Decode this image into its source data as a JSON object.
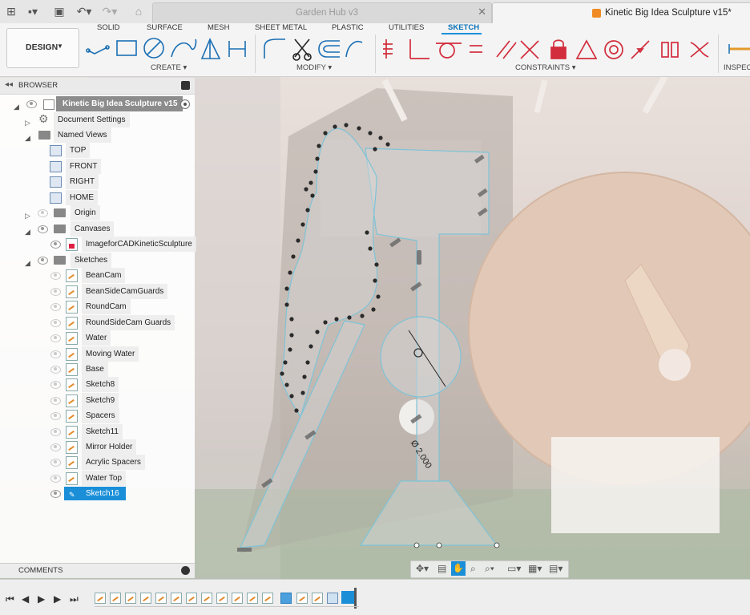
{
  "titlebar": {
    "tab_inactive": "Garden Hub v3",
    "tab_active": "Kinetic Big Idea Sculpture v15*"
  },
  "toolbar": {
    "workspace": "DESIGN",
    "tabs": [
      "SOLID",
      "SURFACE",
      "MESH",
      "SHEET METAL",
      "PLASTIC",
      "UTILITIES",
      "SKETCH"
    ],
    "groups": {
      "create": "CREATE",
      "modify": "MODIFY",
      "constraints": "CONSTRAINTS",
      "inspect": "INSPECT"
    }
  },
  "browser": {
    "title": "BROWSER",
    "root": "Kinetic Big Idea Sculpture v15",
    "document_settings": "Document Settings",
    "named_views": "Named Views",
    "views": [
      "TOP",
      "FRONT",
      "RIGHT",
      "HOME"
    ],
    "origin": "Origin",
    "canvases": "Canvases",
    "canvas_item": "ImageforCADKineticSculpture",
    "sketches": "Sketches",
    "sketch_items": [
      "BeanCam",
      "BeanSideCamGuards",
      "RoundCam",
      "RoundSideCam Guards",
      "Water",
      "Moving Water",
      "Base",
      "Sketch8",
      "Sketch9",
      "Spacers",
      "Sketch11",
      "Mirror Holder",
      "Acrylic Spacers",
      "Water Top",
      "Sketch16"
    ]
  },
  "canvas": {
    "dimension": "Ø 2.000"
  },
  "comments": {
    "label": "COMMENTS"
  },
  "colors": {
    "accent": "#1a8fd8",
    "selected": "#1a8fd8",
    "sketch_line": "#7fc3d6"
  }
}
